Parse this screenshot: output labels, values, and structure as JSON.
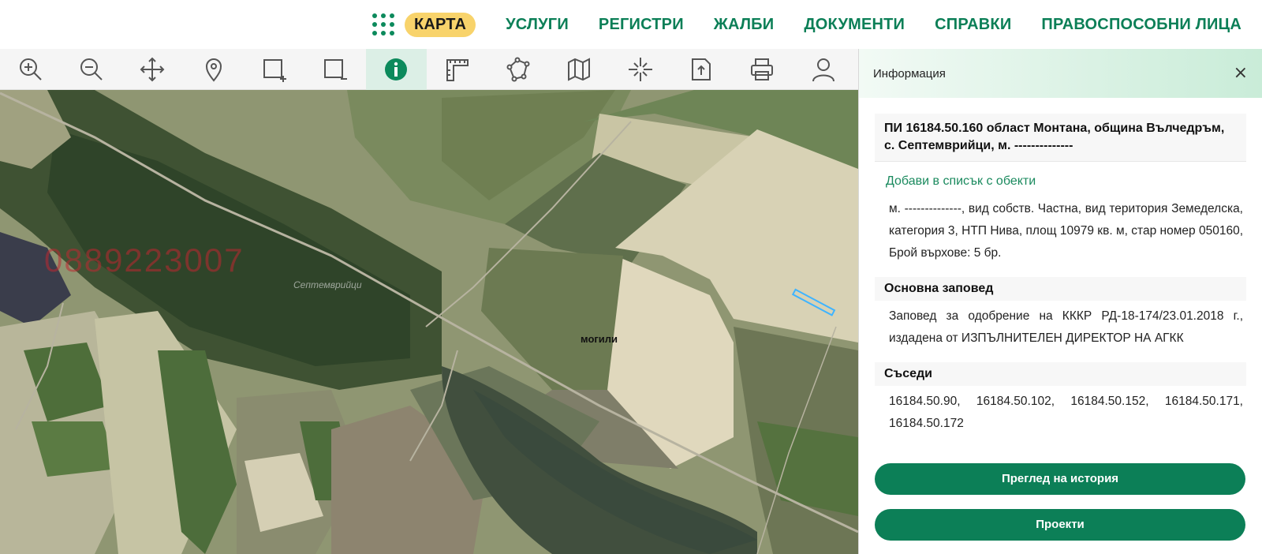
{
  "nav": {
    "items": [
      {
        "label": "КАРТА",
        "active": true
      },
      {
        "label": "УСЛУГИ"
      },
      {
        "label": "РЕГИСТРИ"
      },
      {
        "label": "ЖАЛБИ"
      },
      {
        "label": "ДОКУМЕНТИ"
      },
      {
        "label": "СПРАВКИ"
      },
      {
        "label": "ПРАВОСПОСОБНИ ЛИЦА"
      }
    ]
  },
  "toolbar": {
    "tools": [
      "zoom-in-icon",
      "zoom-out-icon",
      "pan-icon",
      "location-pin-icon",
      "select-rectangle-add-icon",
      "select-rectangle-remove-icon",
      "info-icon",
      "measure-icon",
      "polygon-icon",
      "map-layers-icon",
      "crosshair-icon",
      "upload-file-icon",
      "print-icon",
      "user-icon"
    ],
    "active": "info-icon"
  },
  "map": {
    "label_mogili": "могили",
    "watermark": "0889223007",
    "village_name": "Септемврийци"
  },
  "panel": {
    "title": "Информация",
    "close": "×",
    "property_title": "ПИ 16184.50.160 област Монтана, община Вълчедръм, с. Септемврийци, м. --------------",
    "add_link": "Добави в списък с обекти",
    "description": "м. --------------, вид собств. Частна, вид територия Земеделска, категория 3, НТП Нива, площ 10979 кв. м, стар номер 050160, Брой върхове: 5 бр.",
    "order_heading": "Основна заповед",
    "order_text": "Заповед за одобрение на КККР РД-18-174/23.01.2018 г., издадена от ИЗПЪЛНИТЕЛЕН ДИРЕКТОР НА АГКК",
    "neighbors_heading": "Съседи",
    "neighbors_text": "16184.50.90, 16184.50.102, 16184.50.152, 16184.50.171, 16184.50.172",
    "history_button": "Преглед на история",
    "projects_button": "Проекти"
  },
  "colors": {
    "brand_green": "#0c7f57",
    "active_nav": "#f8d36b",
    "parcel_outline": "#3fb4ff"
  }
}
